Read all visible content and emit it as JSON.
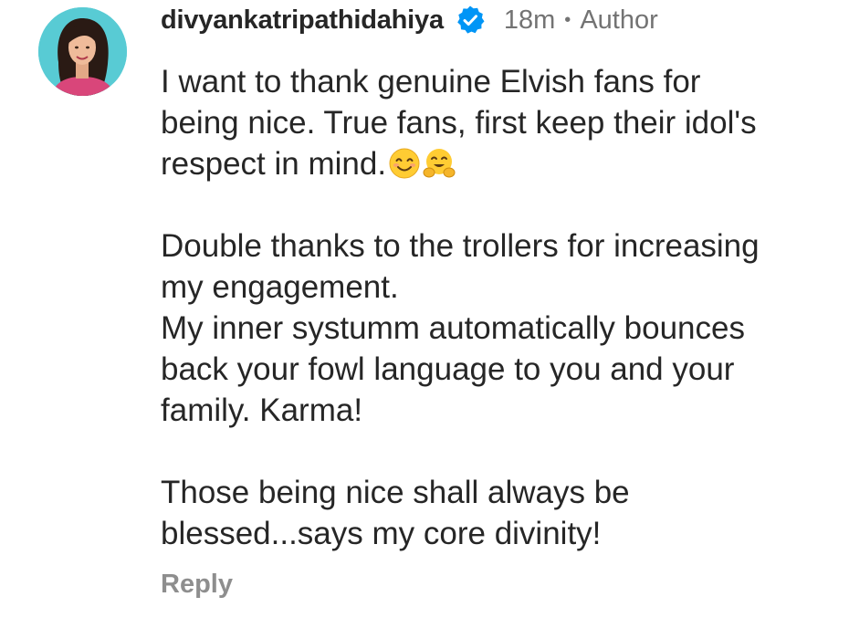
{
  "comment": {
    "username": "divyankatripathidahiya",
    "verified_icon": "verified-badge-icon",
    "time": "18m",
    "separator": "•",
    "role": "Author",
    "paragraphs": [
      {
        "lines": [
          "I want to thank genuine Elvish fans for",
          "being nice. True fans, first keep their idol's",
          "respect in mind."
        ],
        "trailing_emojis": [
          "smiling-face-emoji",
          "hugging-face-emoji"
        ]
      },
      {
        "lines": [
          "Double thanks to the trollers for increasing",
          "my engagement.",
          "My inner systumm automatically bounces",
          "back your fowl language to you and your",
          "family. Karma!"
        ]
      },
      {
        "lines": [
          "Those being nice shall always be",
          "blessed...says my core divinity!"
        ]
      }
    ],
    "reply_label": "Reply"
  },
  "colors": {
    "text": "#262626",
    "secondary": "#737373",
    "reply": "#8e8e8e",
    "verified": "#0095f6",
    "avatar_bg": "#58cbd4"
  }
}
